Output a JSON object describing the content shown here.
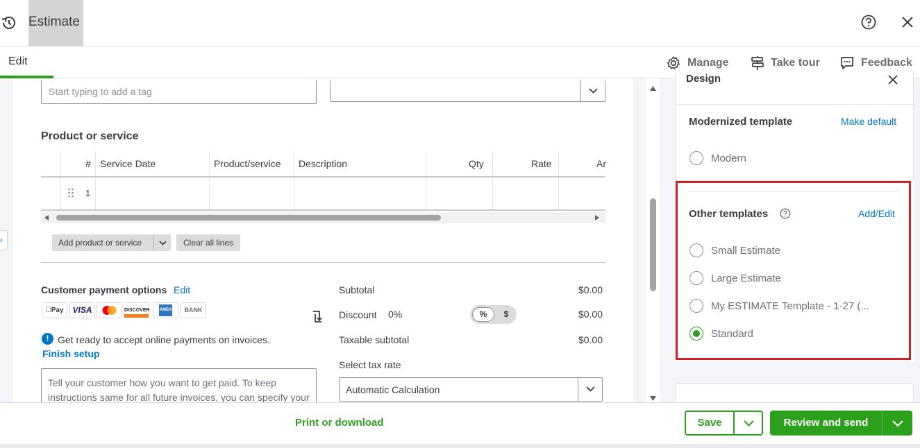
{
  "window": {
    "title": "Estimate"
  },
  "tabs": {
    "edit_label": "Edit"
  },
  "subbar": {
    "manage_label": "Manage",
    "take_tour_label": "Take tour",
    "feedback_label": "Feedback"
  },
  "form": {
    "tags_placeholder": "Start typing to add a tag",
    "product_heading": "Product or service",
    "table": {
      "headers": [
        "#",
        "Service Date",
        "Product/service",
        "Description",
        "Qty",
        "Rate",
        "Ar"
      ],
      "rows": [
        {
          "num": "1"
        }
      ]
    },
    "add_product_label": "Add product or service",
    "clear_lines_label": "Clear all lines",
    "payment": {
      "title": "Customer payment options",
      "edit_label": "Edit",
      "icons": [
        "Pay",
        "VISA",
        "",
        "DISCOVER",
        "AMEX",
        "BANK"
      ],
      "ready_text": "Get ready to accept online payments on invoices.",
      "finish_setup": "Finish setup",
      "textarea_text": "Tell your customer how you want to get paid. To keep instructions same for all future invoices, you can specify your"
    },
    "summary": {
      "subtotal_label": "Subtotal",
      "subtotal_value": "$0.00",
      "discount_label": "Discount",
      "discount_pct": "0%",
      "discount_value": "$0.00",
      "toggle_pct": "%",
      "toggle_dollar": "$",
      "taxable_label": "Taxable subtotal",
      "taxable_value": "$0.00",
      "tax_rate_label": "Select tax rate",
      "tax_rate_value": "Automatic Calculation"
    }
  },
  "design_panel": {
    "design_label": "Design",
    "modernized_label": "Modernized template",
    "make_default": "Make default",
    "modern_option": "Modern",
    "other_label": "Other templates",
    "add_edit": "Add/Edit",
    "templates": [
      {
        "label": "Small Estimate",
        "selected": false
      },
      {
        "label": "Large Estimate",
        "selected": false
      },
      {
        "label": "My ESTIMATE Template - 1-27 (...",
        "selected": false
      },
      {
        "label": "Standard",
        "selected": true
      }
    ]
  },
  "footer": {
    "print_download": "Print or download",
    "save_label": "Save",
    "review_send_label": "Review and send"
  },
  "colors": {
    "accent_green": "#2ca01c",
    "link_blue": "#0077c5",
    "highlight_red": "#d01f26"
  }
}
